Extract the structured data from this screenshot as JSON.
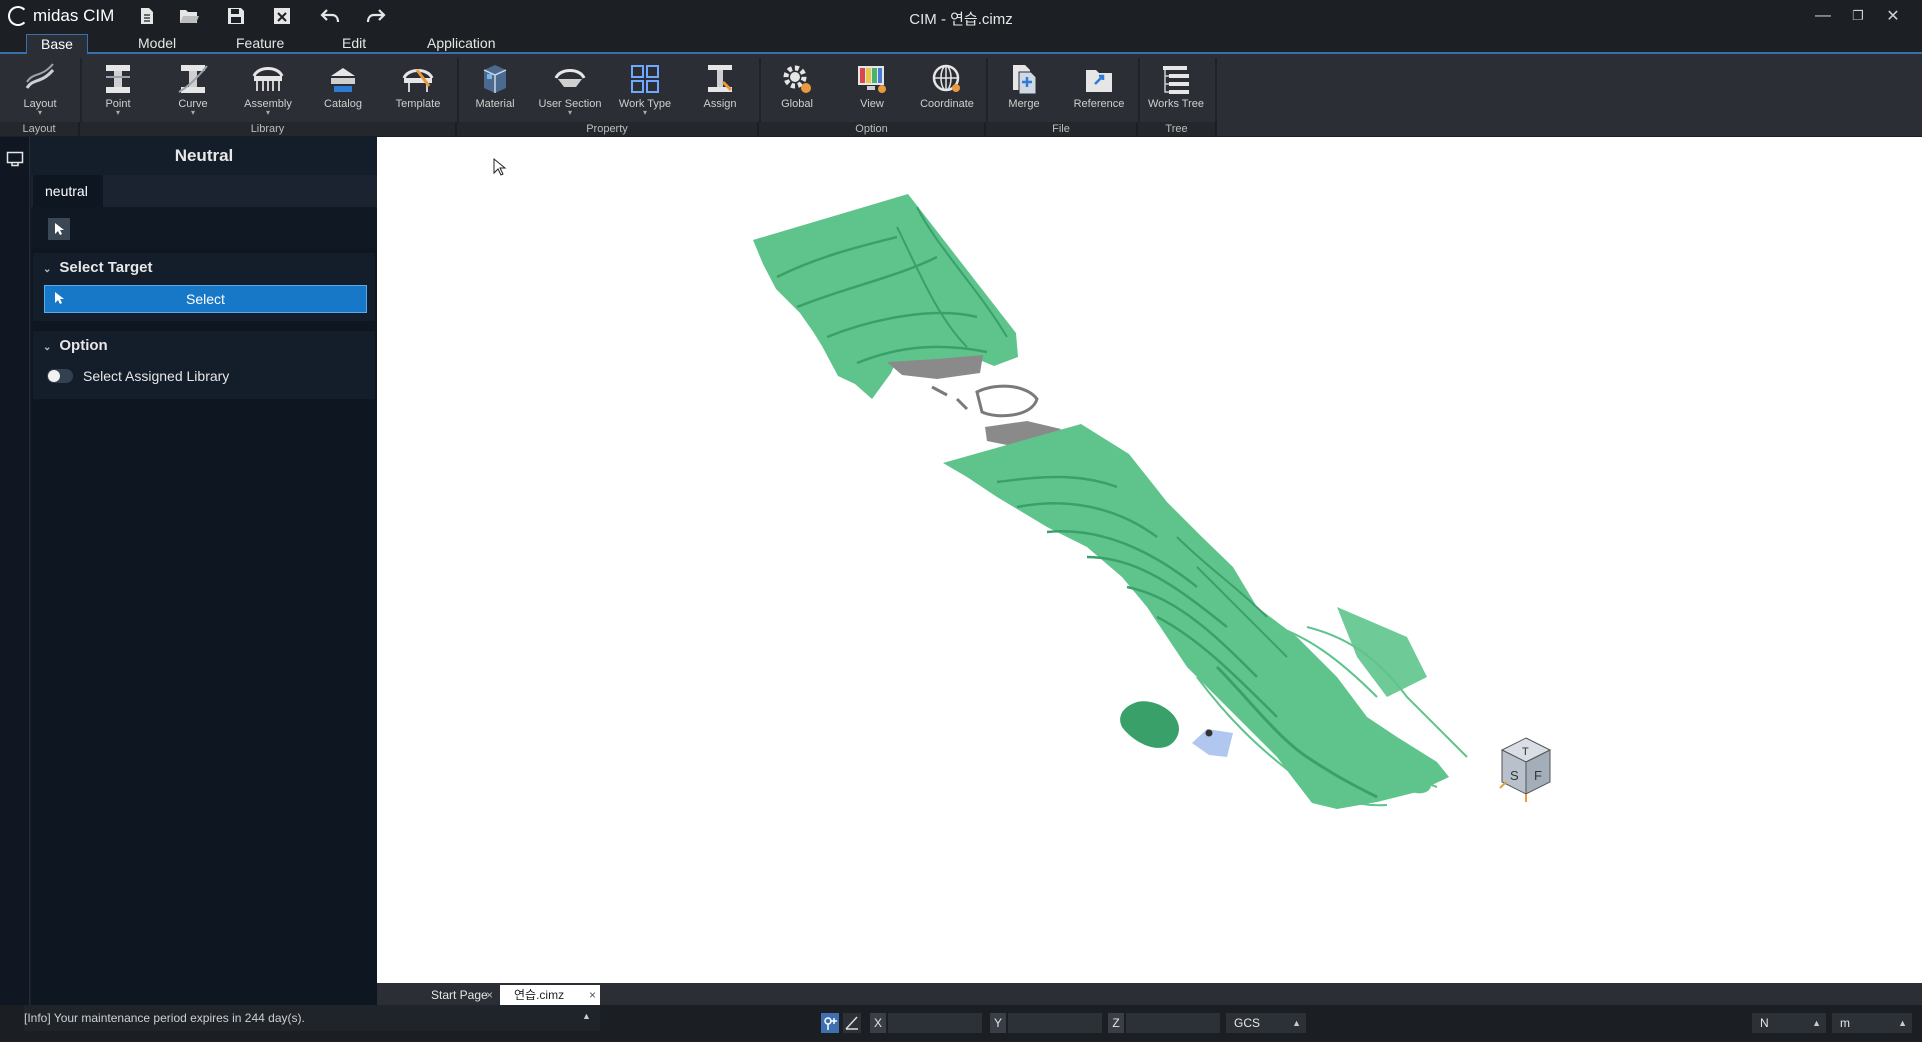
{
  "app": {
    "name": "midas CIM",
    "window_title": "CIM - 연습.cimz"
  },
  "menu_tabs": [
    "Base",
    "Model",
    "Feature",
    "Edit",
    "Application"
  ],
  "ribbon": {
    "buttons": [
      {
        "label": "Layout",
        "icon": "layout-icon"
      },
      {
        "label": "Point",
        "icon": "point-icon"
      },
      {
        "label": "Curve",
        "icon": "curve-icon"
      },
      {
        "label": "Assembly",
        "icon": "assembly-icon"
      },
      {
        "label": "Catalog",
        "icon": "catalog-icon"
      },
      {
        "label": "Template",
        "icon": "template-icon"
      },
      {
        "label": "Material",
        "icon": "material-icon"
      },
      {
        "label": "User Section",
        "icon": "user-section-icon"
      },
      {
        "label": "Work Type",
        "icon": "work-type-icon"
      },
      {
        "label": "Assign",
        "icon": "assign-icon"
      },
      {
        "label": "Global",
        "icon": "gear-icon"
      },
      {
        "label": "View",
        "icon": "view-icon"
      },
      {
        "label": "Coordinate",
        "icon": "coordinate-icon"
      },
      {
        "label": "Merge",
        "icon": "merge-icon"
      },
      {
        "label": "Reference",
        "icon": "reference-icon"
      },
      {
        "label": "Works Tree",
        "icon": "works-tree-icon"
      }
    ],
    "groups": [
      "Layout",
      "Library",
      "Property",
      "Option",
      "File",
      "Tree"
    ]
  },
  "panel": {
    "title": "Neutral",
    "tab": "neutral",
    "select_target": {
      "heading": "Select Target",
      "button": "Select"
    },
    "option": {
      "heading": "Option",
      "toggle_label": "Select Assigned Library",
      "toggle_on": false
    }
  },
  "doc_tabs": [
    "Start Page",
    "연습.cimz"
  ],
  "status": {
    "message": "[Info] Your maintenance period expires in 244 day(s).",
    "coords": {
      "x_label": "X",
      "y_label": "Y",
      "z_label": "Z",
      "x": "",
      "y": "",
      "z": ""
    },
    "coord_system": "GCS",
    "force_unit": "N",
    "length_unit": "m"
  },
  "view_cube": {
    "faces": [
      "T",
      "S",
      "F"
    ]
  },
  "colors": {
    "accent": "#1878c8",
    "terrain": "#5ec48c",
    "terrain_dark": "#3aa06a",
    "road": "#7a7a7a"
  }
}
